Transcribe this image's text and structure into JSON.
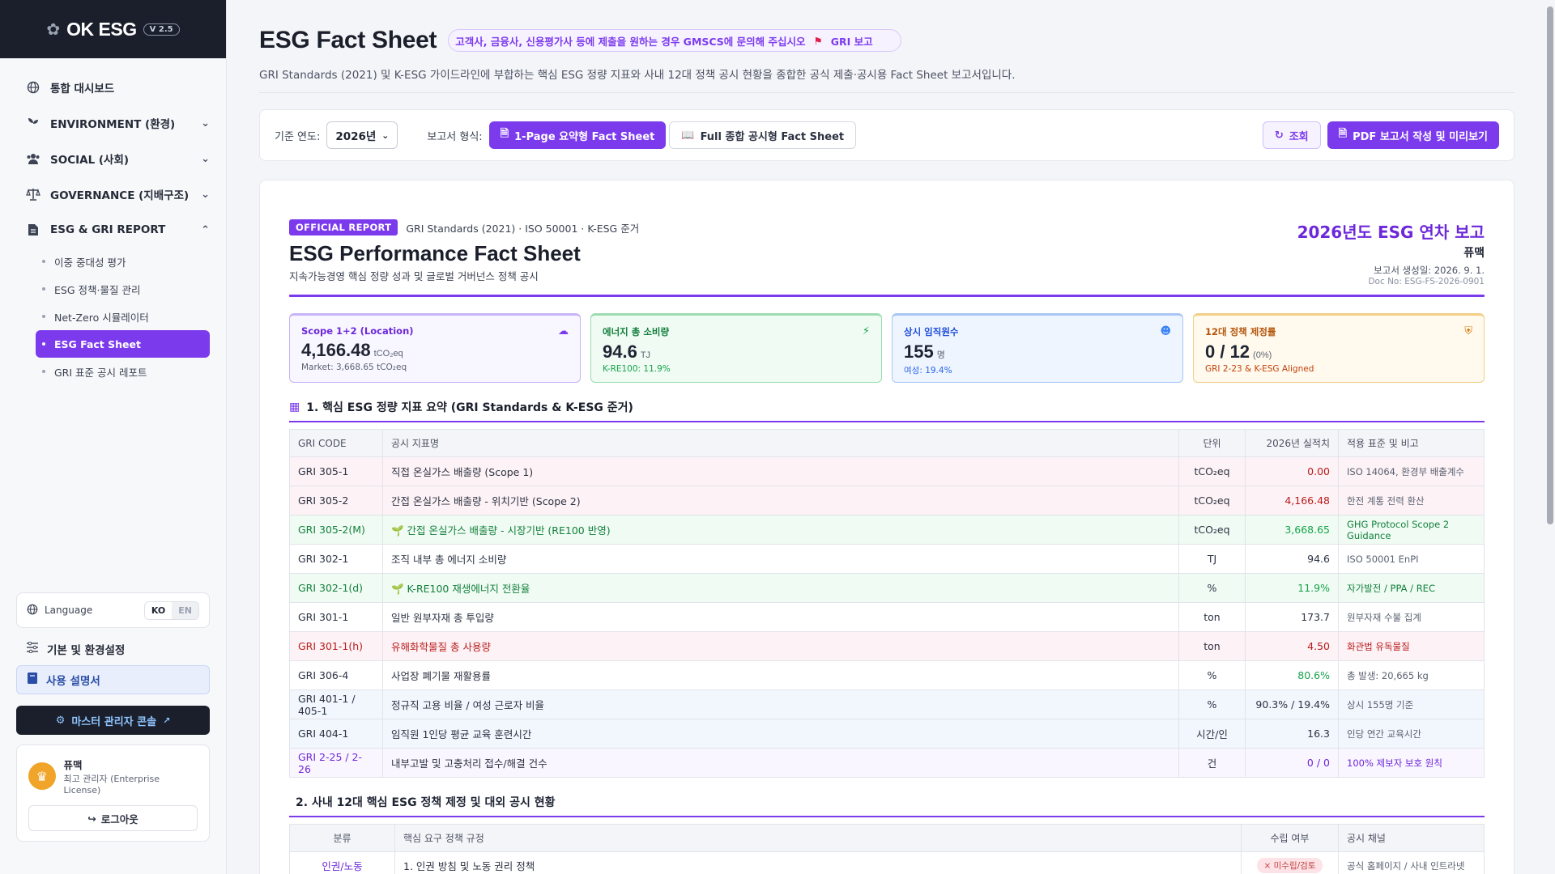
{
  "brand": {
    "name": "OK ESG",
    "version": "V 2.5"
  },
  "nav": {
    "dashboard": "통합 대시보드",
    "environment": "ENVIRONMENT (환경)",
    "social": "SOCIAL (사회)",
    "governance": "GOVERNANCE (지배구조)",
    "report": "ESG & GRI REPORT",
    "sub": [
      "이중 중대성 평가",
      "ESG 정책·물질 관리",
      "Net-Zero 시뮬레이터",
      "ESG Fact Sheet",
      "GRI 표준 공시 레포트"
    ]
  },
  "sidebar_bottom": {
    "language_label": "Language",
    "lang_ko": "KO",
    "lang_en": "EN",
    "settings": "기본 및 환경설정",
    "manual": "사용 설명서",
    "master": "마스터 관리자 콘솔",
    "user_name": "퓨맥",
    "user_role": "최고 관리자 (Enterprise License)",
    "logout": "로그아웃"
  },
  "header": {
    "title": "ESG Fact Sheet",
    "ticker": "고객사, 금융사, 신용평가사 등에 제출을 원하는 경우 GMSCS에 문의해 주십시오",
    "ticker_tail": "GRI 보고",
    "desc": "GRI Standards (2021) 및 K-ESG 가이드라인에 부합하는 핵심 ESG 정량 지표와 사내 12대 정책 공시 현황을 종합한 공식 제출·공시용 Fact Sheet 보고서입니다."
  },
  "toolbar": {
    "year_label": "기준 연도:",
    "year": "2026년",
    "format_label": "보고서 형식:",
    "fmt1": "1-Page 요약형 Fact Sheet",
    "fmt2": "Full 종합 공시형 Fact Sheet",
    "query": "조회",
    "pdf": "PDF 보고서 작성 및 미리보기"
  },
  "report": {
    "badge": "OFFICIAL REPORT",
    "standards": "GRI Standards (2021) · ISO 50001 · K-ESG 준거",
    "title": "ESG Performance Fact Sheet",
    "subtitle": "지속가능경영 핵심 정량 성과 및 글로벌 거버넌스 정책 공시",
    "year_title": "2026년도 ESG 연차 보고",
    "org": "퓨맥",
    "generated": "보고서 생성일: 2026. 9. 1.",
    "doc_no": "Doc No: ESG-FS-2026-0901"
  },
  "kpis": [
    {
      "label": "Scope 1+2 (Location)",
      "value": "4,166.48",
      "unit": "tCO₂eq",
      "note": "Market: 3,668.65 tCO₂eq",
      "icon": "cloud-icon"
    },
    {
      "label": "에너지 총 소비량",
      "value": "94.6",
      "unit": "TJ",
      "note": "K-RE100: 11.9%",
      "icon": "bolt-icon"
    },
    {
      "label": "상시 임직원수",
      "value": "155",
      "unit": "명",
      "note": "여성: 19.4%",
      "icon": "users-icon"
    },
    {
      "label": "12대 정책 제정률",
      "value": "0 / 12",
      "unit": "(0%)",
      "note": "GRI 2-23 & K-ESG Aligned",
      "icon": "shield-icon"
    }
  ],
  "section1": {
    "title": "1. 핵심 ESG 정량 지표 요약 (GRI Standards & K-ESG 준거)",
    "headers": [
      "GRI CODE",
      "공시 지표명",
      "단위",
      "2026년 실적치",
      "적용 표준 및 비고"
    ],
    "rows": [
      {
        "code": "GRI 305-1",
        "name": "직접 온실가스 배출량 (Scope 1)",
        "unit": "tCO₂eq",
        "value": "0.00",
        "note": "ISO 14064, 환경부 배출계수"
      },
      {
        "code": "GRI 305-2",
        "name": "간접 온실가스 배출량 - 위치기반 (Scope 2)",
        "unit": "tCO₂eq",
        "value": "4,166.48",
        "note": "한전 계통 전력 환산"
      },
      {
        "code": "GRI 305-2(M)",
        "name": "간접 온실가스 배출량 - 시장기반 (RE100 반영)",
        "unit": "tCO₂eq",
        "value": "3,668.65",
        "note": "GHG Protocol Scope 2 Guidance"
      },
      {
        "code": "GRI 302-1",
        "name": "조직 내부 총 에너지 소비량",
        "unit": "TJ",
        "value": "94.6",
        "note": "ISO 50001 EnPI"
      },
      {
        "code": "GRI 302-1(d)",
        "name": "K-RE100 재생에너지 전환율",
        "unit": "%",
        "value": "11.9%",
        "note": "자가발전 / PPA / REC"
      },
      {
        "code": "GRI 301-1",
        "name": "일반 원부자재 총 투입량",
        "unit": "ton",
        "value": "173.7",
        "note": "원부자재 수불 집계"
      },
      {
        "code": "GRI 301-1(h)",
        "name": "유해화학물질 총 사용량",
        "unit": "ton",
        "value": "4.50",
        "note": "화관법 유독물질"
      },
      {
        "code": "GRI 306-4",
        "name": "사업장 폐기물 재활용률",
        "unit": "%",
        "value": "80.6%",
        "note": "총 발생: 20,665 kg"
      },
      {
        "code": "GRI 401-1 / 405-1",
        "name": "정규직 고용 비율 / 여성 근로자 비율",
        "unit": "%",
        "value": "90.3% / 19.4%",
        "note": "상시 155명 기준"
      },
      {
        "code": "GRI 404-1",
        "name": "임직원 1인당 평균 교육 훈련시간",
        "unit": "시간/인",
        "value": "16.3",
        "note": "인당 연간 교육시간"
      },
      {
        "code": "GRI 2-25 / 2-26",
        "name": "내부고발 및 고충처리 접수/해결 건수",
        "unit": "건",
        "value": "0 / 0",
        "note": "100% 제보자 보호 원칙"
      }
    ]
  },
  "section2": {
    "title": "2. 사내 12대 핵심 ESG 정책 제정 및 대외 공시 현황",
    "headers": [
      "분류",
      "핵심 요구 정책 규정",
      "수립 여부",
      "공시 채널"
    ],
    "rows": [
      {
        "cat": "인권/노동",
        "policy": "1. 인권 방침 및 노동 권리 정책",
        "status": "× 미수립/검토",
        "channel": "공식 홈페이지 / 사내 인트라넷"
      }
    ]
  }
}
